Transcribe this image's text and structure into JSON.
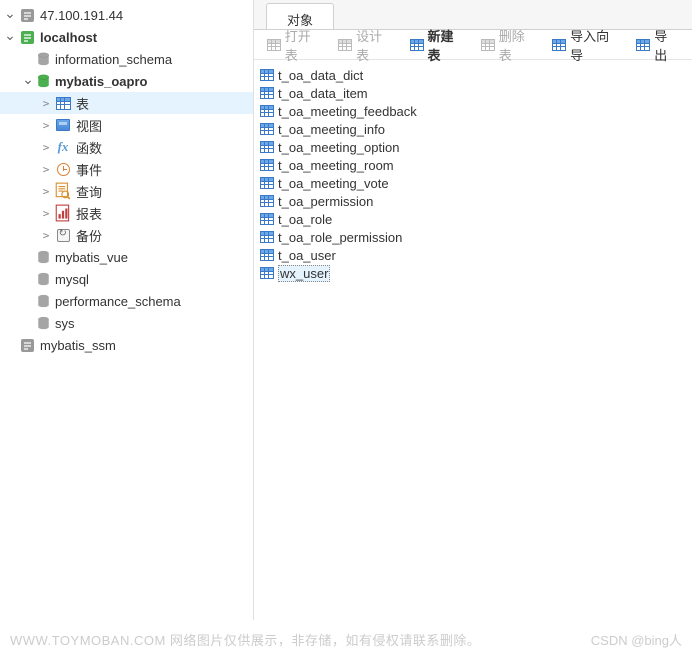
{
  "tree": {
    "conn1": "47.100.191.44",
    "conn2": "localhost",
    "db_info": "information_schema",
    "db_active": "mybatis_oapro",
    "nodes": {
      "tables": "表",
      "views": "视图",
      "functions": "函数",
      "events": "事件",
      "queries": "查询",
      "reports": "报表",
      "backups": "备份"
    },
    "db_vue": "mybatis_vue",
    "db_mysql": "mysql",
    "db_perf": "performance_schema",
    "db_sys": "sys",
    "conn3": "mybatis_ssm"
  },
  "tab": {
    "label": "对象"
  },
  "toolbar": {
    "open": "打开表",
    "design": "设计表",
    "new": "新建表",
    "delete": "删除表",
    "import": "导入向导",
    "export": "导出"
  },
  "tables": [
    "t_oa_data_dict",
    "t_oa_data_item",
    "t_oa_meeting_feedback",
    "t_oa_meeting_info",
    "t_oa_meeting_option",
    "t_oa_meeting_room",
    "t_oa_meeting_vote",
    "t_oa_permission",
    "t_oa_role",
    "t_oa_role_permission",
    "t_oa_user",
    "wx_user"
  ],
  "footer": {
    "left": "WWW.TOYMOBAN.COM 网络图片仅供展示，非存储，如有侵权请联系删除。",
    "right": "CSDN @bing人"
  }
}
